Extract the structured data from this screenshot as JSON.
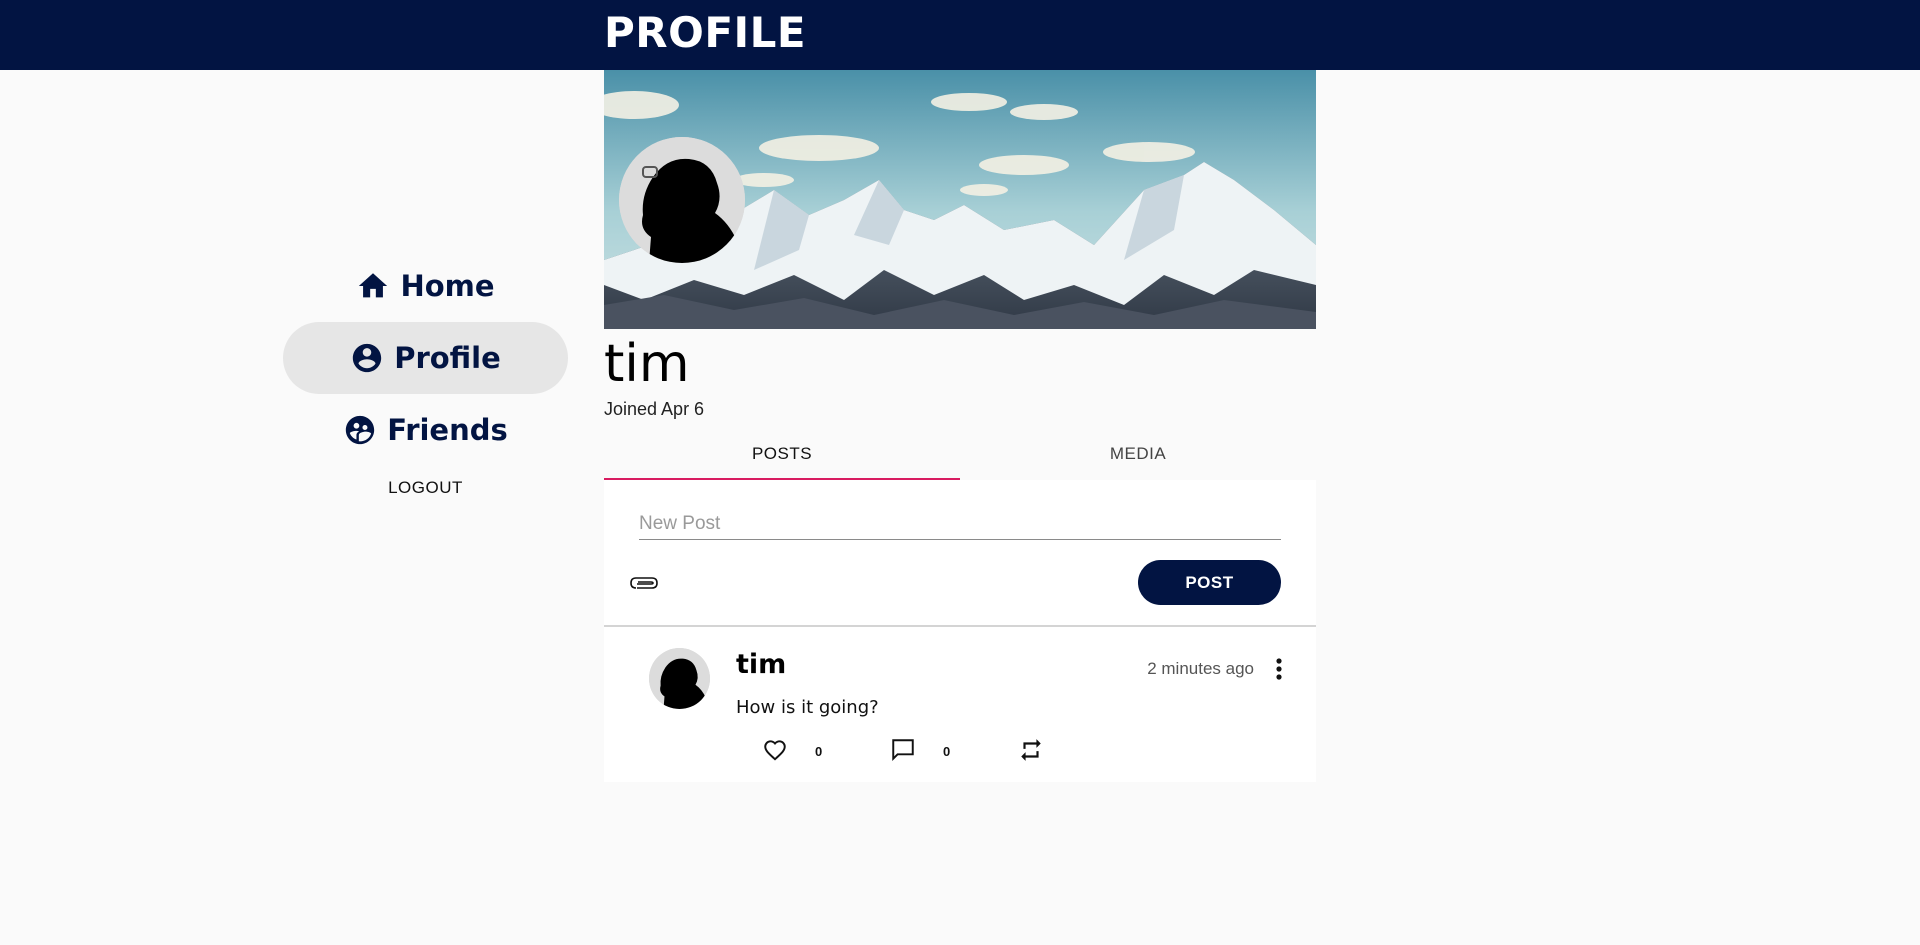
{
  "header": {
    "title": "PROFILE"
  },
  "sidebar": {
    "items": [
      {
        "label": "Home",
        "icon": "home-icon",
        "active": false
      },
      {
        "label": "Profile",
        "icon": "account-circle-icon",
        "active": true
      },
      {
        "label": "Friends",
        "icon": "friends-icon",
        "active": false
      }
    ],
    "logout_label": "LOGOUT"
  },
  "profile": {
    "name": "tim",
    "joined": "Joined Apr 6"
  },
  "tabs": [
    {
      "label": "POSTS",
      "active": true
    },
    {
      "label": "MEDIA",
      "active": false
    }
  ],
  "composer": {
    "placeholder": "New Post",
    "post_label": "POST"
  },
  "posts": [
    {
      "author": "tim",
      "time": "2 minutes ago",
      "text": "How is it going?",
      "likes": "0",
      "comments": "0"
    }
  ],
  "colors": {
    "primary": "#021442",
    "accent": "#d81b60",
    "background": "#fafafa"
  }
}
